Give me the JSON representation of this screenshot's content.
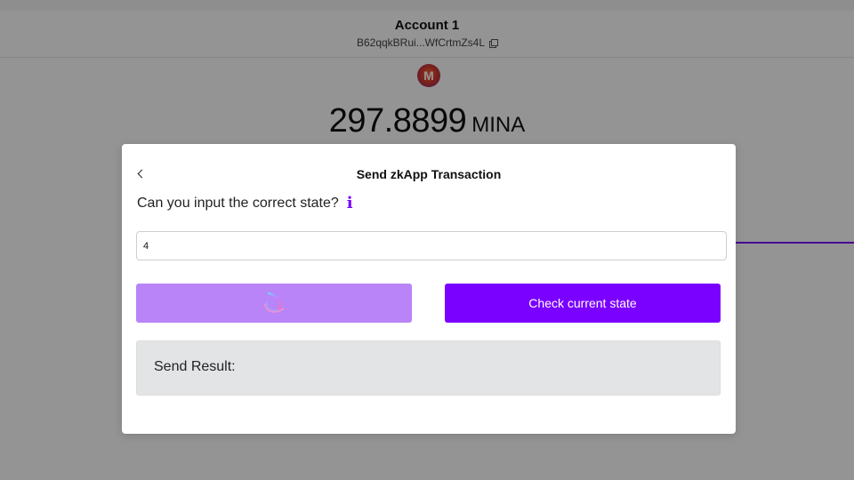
{
  "account": {
    "name": "Account 1",
    "address": "B62qqkBRui...WfCrtmZs4L"
  },
  "balance": {
    "amount": "297.8899",
    "unit": "MINA"
  },
  "token_logo_letter": "M",
  "modal": {
    "title": "Send zkApp Transaction",
    "question": "Can you input the correct state?",
    "info_symbol": "i",
    "input_value": "4",
    "send_button_state": "loading",
    "check_button_label": "Check current state",
    "result_label": "Send Result:"
  },
  "colors": {
    "accent": "#7a00ff",
    "accent_light": "#b884f7",
    "result_bg": "#e3e4e6"
  },
  "icons": {
    "back": "chevron-left-icon",
    "copy": "copy-icon",
    "info": "info-icon",
    "loading": "spinner-icon"
  }
}
